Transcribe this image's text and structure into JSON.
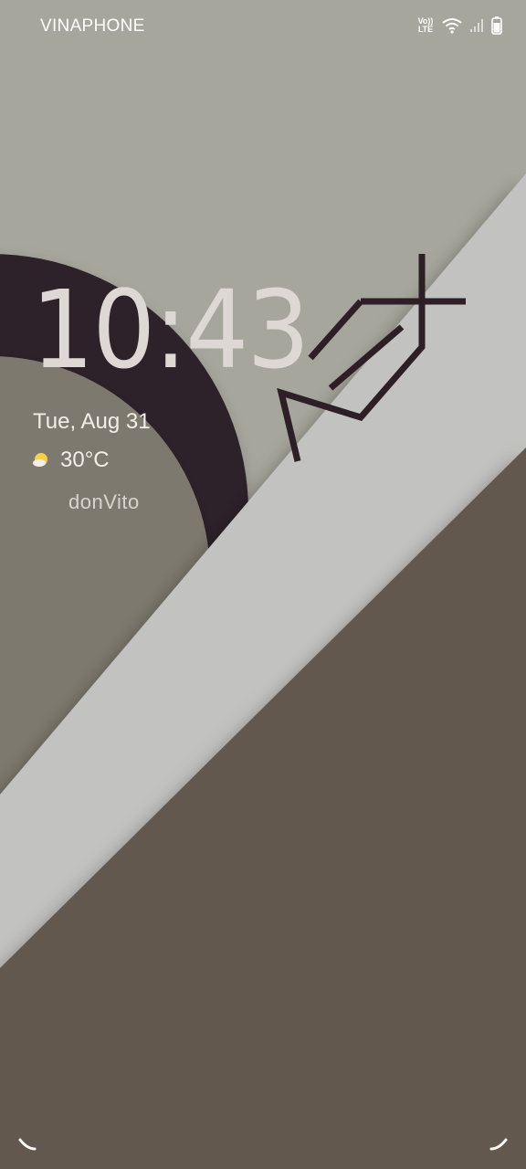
{
  "status_bar": {
    "carrier": "VINAPHONE",
    "volte_top": "Vo))",
    "volte_bottom": "LTE",
    "icons": [
      "volte-icon",
      "wifi-icon",
      "signal-icon",
      "battery-icon"
    ]
  },
  "lockscreen": {
    "time": "10:43",
    "date": "Tue, Aug 31",
    "temperature": "30°C",
    "weather_icon": "sunny-partly-cloudy-icon",
    "owner_info": "donVito"
  },
  "bottom_shortcuts": {
    "left_icon": "phone-shortcut-icon",
    "right_icon": "camera-shortcut-icon"
  },
  "colors": {
    "background": "#a6a69c",
    "dark_ring": "#2e2429",
    "light_band": "#c2c2c0",
    "brown": "#64584d",
    "inner_circle": "#7e796e",
    "text": "#f2efea"
  }
}
